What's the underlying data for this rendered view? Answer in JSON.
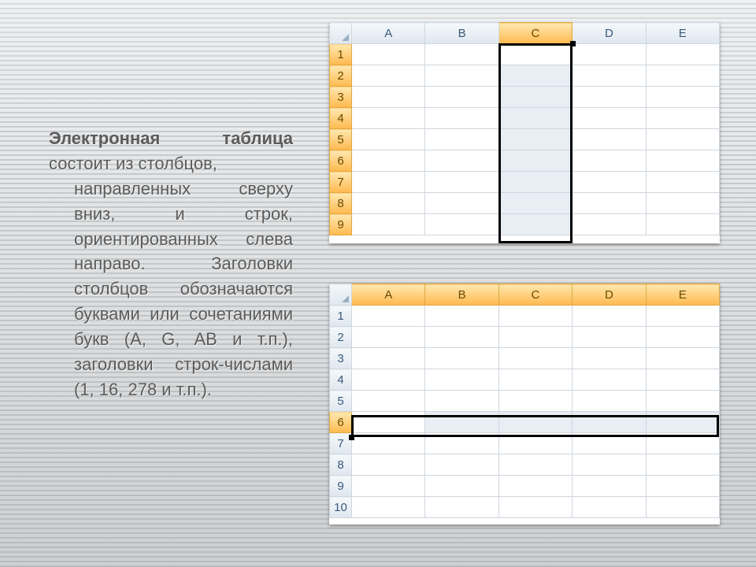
{
  "text": {
    "title_bold": "Электронная таблица",
    "title_rest": " состоит из столбцов, направленных сверху вниз, и строк, ориентированных слева направо. Заголовки столбцов обозначаются буквами или сочетаниями букв (A, G, AB и т.п.), заголовки строк-числами (1, 16, 278 и т.п.)."
  },
  "sheet_top": {
    "columns": [
      "A",
      "B",
      "C",
      "D",
      "E"
    ],
    "rows": [
      "1",
      "2",
      "3",
      "4",
      "5",
      "6",
      "7",
      "8",
      "9"
    ],
    "selected_column": "C"
  },
  "sheet_bottom": {
    "columns": [
      "A",
      "B",
      "C",
      "D",
      "E"
    ],
    "rows": [
      "1",
      "2",
      "3",
      "4",
      "5",
      "6",
      "7",
      "8",
      "9",
      "10"
    ],
    "selected_row": "6"
  }
}
